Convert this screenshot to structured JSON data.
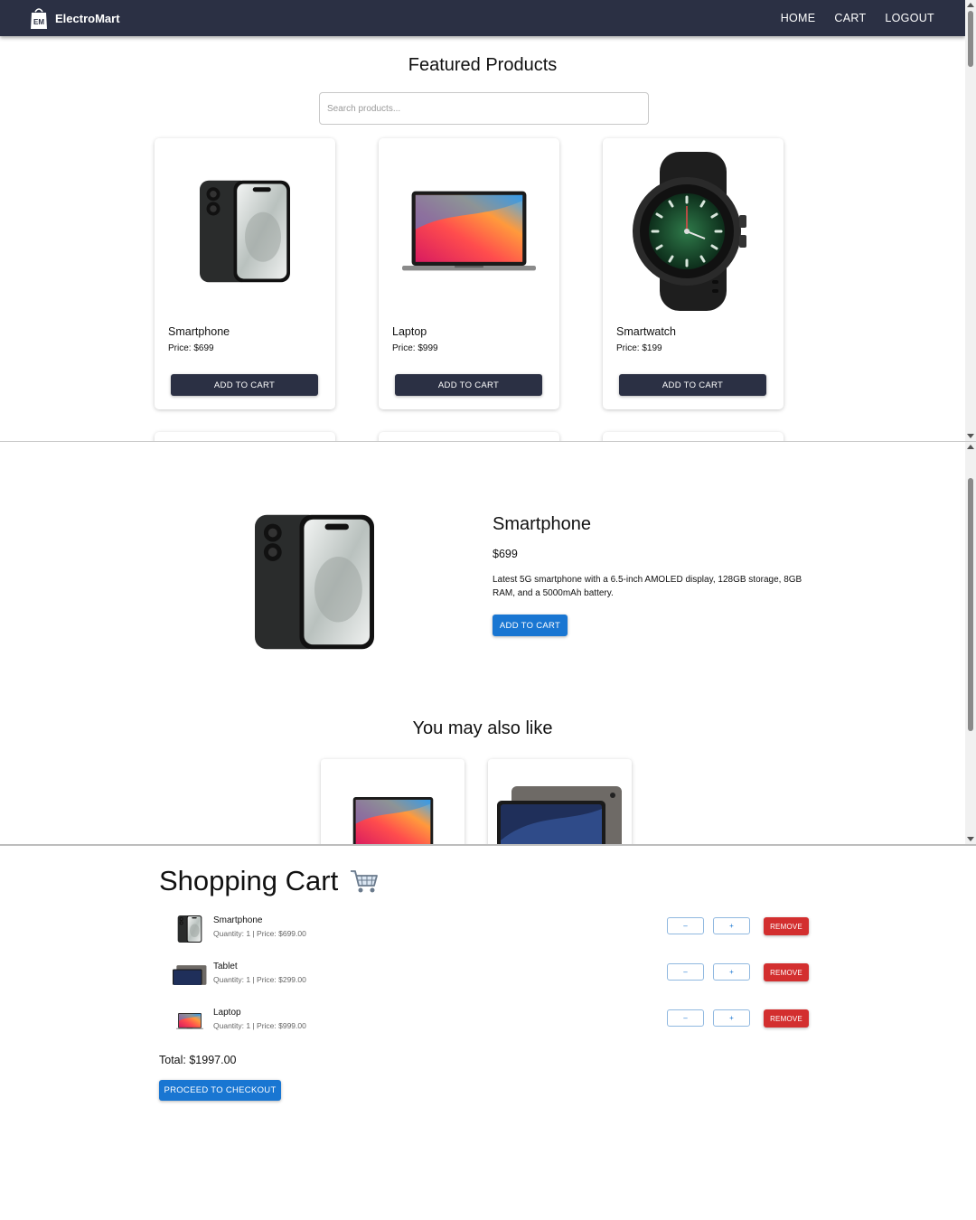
{
  "navbar": {
    "brand": "ElectroMart",
    "links": [
      "HOME",
      "CART",
      "LOGOUT"
    ]
  },
  "catalog": {
    "title": "Featured Products",
    "search_placeholder": "Search products...",
    "products": [
      {
        "name": "Smartphone",
        "price": "Price: $699",
        "button": "ADD TO CART",
        "image": "smartphone-image"
      },
      {
        "name": "Laptop",
        "price": "Price: $999",
        "button": "ADD TO CART",
        "image": "laptop-image"
      },
      {
        "name": "Smartwatch",
        "price": "Price: $199",
        "button": "ADD TO CART",
        "image": "smartwatch-image"
      }
    ]
  },
  "detail": {
    "title": "Smartphone",
    "price": "$699",
    "description": "Latest 5G smartphone with a 6.5-inch AMOLED display, 128GB storage, 8GB RAM, and a 5000mAh battery.",
    "button": "ADD TO CART",
    "related_title": "You may also like"
  },
  "cart": {
    "title": "Shopping Cart",
    "items": [
      {
        "name": "Smartphone",
        "meta": "Quantity: 1 | Price: $699.00",
        "minus": "–",
        "plus": "+",
        "remove": "REMOVE"
      },
      {
        "name": "Tablet",
        "meta": "Quantity: 1 | Price: $299.00",
        "minus": "–",
        "plus": "+",
        "remove": "REMOVE"
      },
      {
        "name": "Laptop",
        "meta": "Quantity: 1 | Price: $999.00",
        "minus": "–",
        "plus": "+",
        "remove": "REMOVE"
      }
    ],
    "total": "Total: $1997.00",
    "checkout": "PROCEED TO CHECKOUT"
  },
  "colors": {
    "navbar": "#2b3044",
    "primary": "#1976d2",
    "danger": "#d32f2f"
  }
}
